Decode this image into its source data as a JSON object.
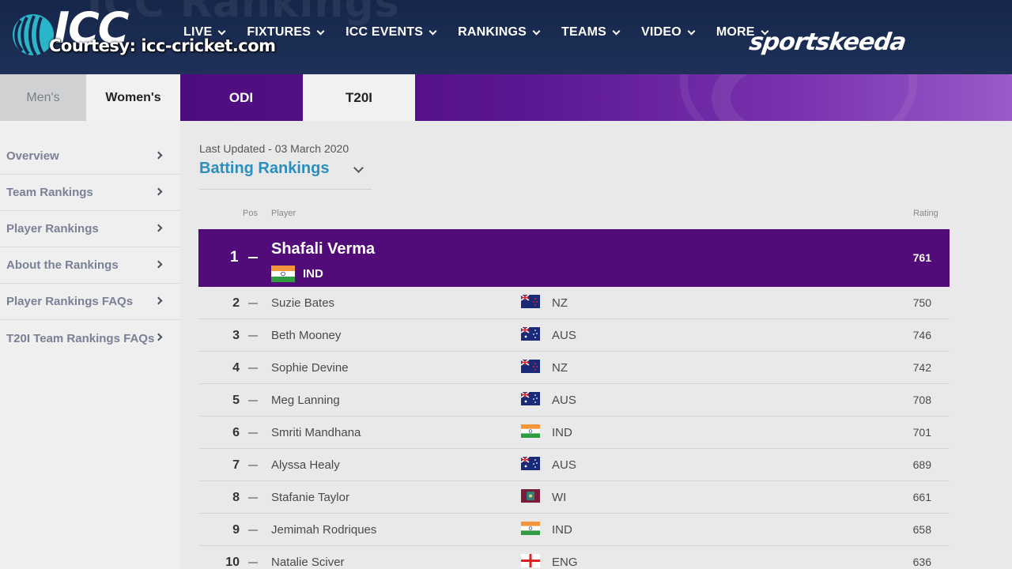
{
  "header": {
    "watermark": "ICC Rankings",
    "logo_text": "ICC",
    "courtesy": "Courtesy: icc-cricket.com",
    "brand": "sportskeeda",
    "nav": [
      {
        "label": "LIVE",
        "icon": "chevron-down-icon"
      },
      {
        "label": "FIXTURES",
        "icon": "chevron-down-icon"
      },
      {
        "label": "ICC EVENTS",
        "icon": "chevron-down-icon"
      },
      {
        "label": "RANKINGS",
        "icon": "chevron-down-icon"
      },
      {
        "label": "TEAMS",
        "icon": "chevron-down-icon"
      },
      {
        "label": "VIDEO",
        "icon": "chevron-down-icon"
      },
      {
        "label": "MORE",
        "icon": "chevron-down-icon"
      }
    ]
  },
  "tabs": {
    "gender": [
      "Men's",
      "Women's"
    ],
    "gender_selected": "Women's",
    "format": [
      "ODI",
      "T20I"
    ],
    "format_selected": "T20I"
  },
  "sidebar": {
    "items": [
      {
        "label": "Overview"
      },
      {
        "label": "Team Rankings"
      },
      {
        "label": "Player Rankings"
      },
      {
        "label": "About the Rankings"
      },
      {
        "label": "Player Rankings FAQs"
      },
      {
        "label": "T20I Team Rankings FAQs"
      }
    ]
  },
  "main": {
    "last_updated": "Last Updated - 03 March 2020",
    "ranking_type": "Batting Rankings",
    "columns": {
      "pos": "Pos",
      "player": "Player",
      "rating": "Rating"
    },
    "leader": {
      "pos": "1",
      "name": "Shafali Verma",
      "team": "IND",
      "rating": "761"
    },
    "rows": [
      {
        "pos": "2",
        "name": "Suzie Bates",
        "team": "NZ",
        "rating": "750"
      },
      {
        "pos": "3",
        "name": "Beth Mooney",
        "team": "AUS",
        "rating": "746"
      },
      {
        "pos": "4",
        "name": "Sophie Devine",
        "team": "NZ",
        "rating": "742"
      },
      {
        "pos": "5",
        "name": "Meg Lanning",
        "team": "AUS",
        "rating": "708"
      },
      {
        "pos": "6",
        "name": "Smriti Mandhana",
        "team": "IND",
        "rating": "701"
      },
      {
        "pos": "7",
        "name": "Alyssa Healy",
        "team": "AUS",
        "rating": "689"
      },
      {
        "pos": "8",
        "name": "Stafanie Taylor",
        "team": "WI",
        "rating": "661"
      },
      {
        "pos": "9",
        "name": "Jemimah Rodriques",
        "team": "IND",
        "rating": "658"
      },
      {
        "pos": "10",
        "name": "Natalie Sciver",
        "team": "ENG",
        "rating": "636"
      }
    ]
  },
  "colors": {
    "accent_purple": "#520c7a",
    "link_blue": "#2a8fc0",
    "header_navy": "#1a2a50"
  }
}
